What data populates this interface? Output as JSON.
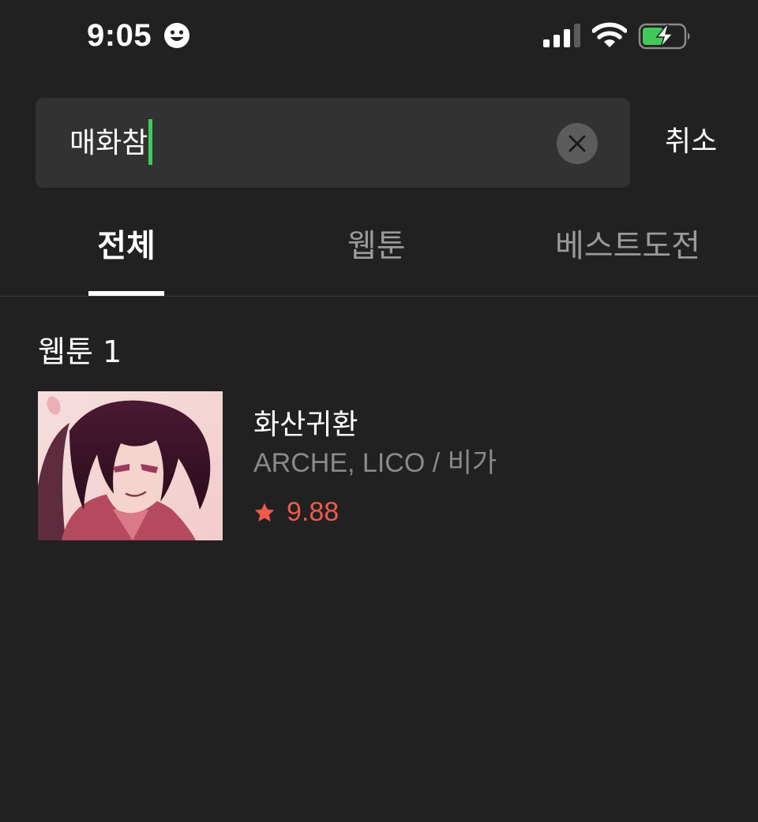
{
  "status_bar": {
    "time": "9:05",
    "icons": [
      "smiley-face-icon",
      "cellular-signal-icon",
      "wifi-icon",
      "battery-charging-icon"
    ]
  },
  "search": {
    "value": "매화참",
    "clear_icon": "close-icon",
    "cancel_label": "취소"
  },
  "tabs": [
    {
      "label": "전체",
      "selected": true
    },
    {
      "label": "웹툰",
      "selected": false
    },
    {
      "label": "베스트도전",
      "selected": false
    }
  ],
  "results": {
    "section_title": "웹툰",
    "section_count": "1",
    "items": [
      {
        "title": "화산귀환",
        "authors": "ARCHE, LICO / 비가",
        "rating_icon": "star-icon",
        "rating": "9.88"
      }
    ]
  },
  "colors": {
    "background": "#212121",
    "search_field": "#323232",
    "caret": "#43c95b",
    "rating": "#f0594c",
    "tab_inactive": "#9a9a9a",
    "author_text": "#8a8a8a",
    "battery_fill": "#43c95b"
  }
}
